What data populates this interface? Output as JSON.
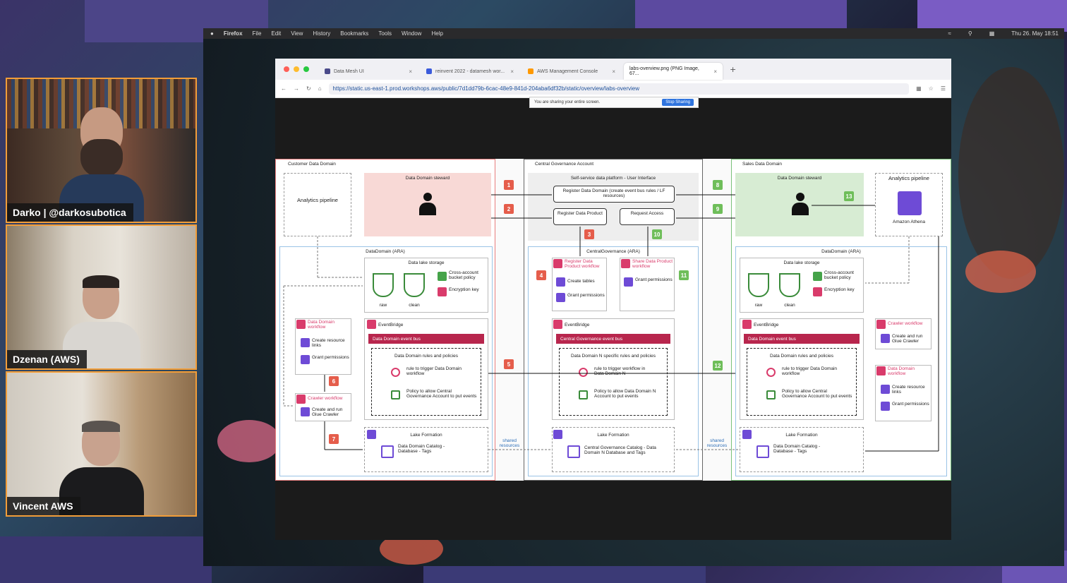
{
  "participants": [
    {
      "name": "Darko | @darkosubotica"
    },
    {
      "name": "Dzenan (AWS)"
    },
    {
      "name": "Vincent AWS"
    }
  ],
  "mac_menubar": {
    "app": "Firefox",
    "menus": [
      "File",
      "Edit",
      "View",
      "History",
      "Bookmarks",
      "Tools",
      "Window",
      "Help"
    ],
    "clock": "Thu 26. May 18:51"
  },
  "browser": {
    "tabs": [
      {
        "title": "Data Mesh UI",
        "color": "#4a4a8a"
      },
      {
        "title": "reinvent 2022 - datamesh wor...",
        "color": "#3b5bdb"
      },
      {
        "title": "AWS Management Console",
        "color": "#ff9900"
      },
      {
        "title": "labs-overview.png (PNG Image, 67...",
        "color": "#888888"
      }
    ],
    "new_tab": "+",
    "url": "https://static.us-east-1.prod.workshops.aws/public/7d1dd79b-6cac-48e9-841d-204aba6df32b/static/overview/labs-overview",
    "share_notice": "You are sharing your entire screen.",
    "stop_sharing": "Stop Sharing"
  },
  "diagram": {
    "customer": {
      "title": "Customer Data Domain",
      "analytics": "Analytics pipeline",
      "steward": "Data Domain steward",
      "account": "DataDomain (ARA)",
      "storage": "Data lake storage",
      "cross": "Cross-account bucket policy",
      "encryption": "Encryption key",
      "raw": "raw",
      "clean": "clean",
      "eventbridge": "EventBridge",
      "eventbus": "Data Domain event bus",
      "rules": "Data Domain rules and policies",
      "rule_trigger": "rule to trigger Data Domain workflow",
      "policy": "Policy to allow Central Governance Account to put events",
      "workflow": "Data Domain workflow",
      "create_links": "Create resource links",
      "grant": "Grant permissions",
      "crawler": "Crawler workflow",
      "crawler_run": "Create and run Glue Crawler",
      "lake": "Lake Formation",
      "catalog": "Data Domain Catalog - Database - Tags"
    },
    "central": {
      "title": "Central Governance Account",
      "platform": "Self-service data platform - User Interface",
      "register_domain": "Register Data Domain (create event bus rules / LF resources)",
      "register_product": "Register Data Product",
      "request": "Request Access",
      "account": "CentralGovernance (ARA)",
      "reg_workflow": "Register Data Product workflow",
      "create_tables": "Create tables",
      "grant": "Grant permissions",
      "share_workflow": "Share Data Product workflow",
      "eventbridge": "EventBridge",
      "eventbus": "Central Governance event bus",
      "rules": "Data Domain N specific rules and policies",
      "rule_trigger": "rule to trigger workflow in Data Domain N",
      "policy": "Policy to allow Data Domain N Account to put events",
      "lake": "Lake Formation",
      "catalog": "Central Governance Catalog - Data Domain N Database and Tags",
      "shared": "shared resources"
    },
    "sales": {
      "title": "Sales Data Domain",
      "steward": "Data Domain steward",
      "analytics": "Analytics pipeline",
      "athena": "Amazon Athena",
      "account": "DataDomain (ARA)",
      "storage": "Data lake storage",
      "cross": "Cross-account bucket policy",
      "encryption": "Encryption key",
      "raw": "raw",
      "clean": "clean",
      "eventbridge": "EventBridge",
      "eventbus": "Data Domain event bus",
      "rules": "Data Domain rules and policies",
      "rule_trigger": "rule to trigger Data Domain workflow",
      "policy": "Policy to allow Central Governance Account to put events",
      "crawler": "Crawler workflow",
      "crawler_run": "Create and run Glue Crawler",
      "workflow": "Data Domain workflow",
      "create_links": "Create resource links",
      "grant": "Grant permissions",
      "lake": "Lake Formation",
      "catalog": "Data Domain Catalog - Database - Tags"
    },
    "steps": [
      "1",
      "2",
      "3",
      "4",
      "5",
      "6",
      "7",
      "8",
      "9",
      "10",
      "11",
      "12",
      "13"
    ]
  }
}
